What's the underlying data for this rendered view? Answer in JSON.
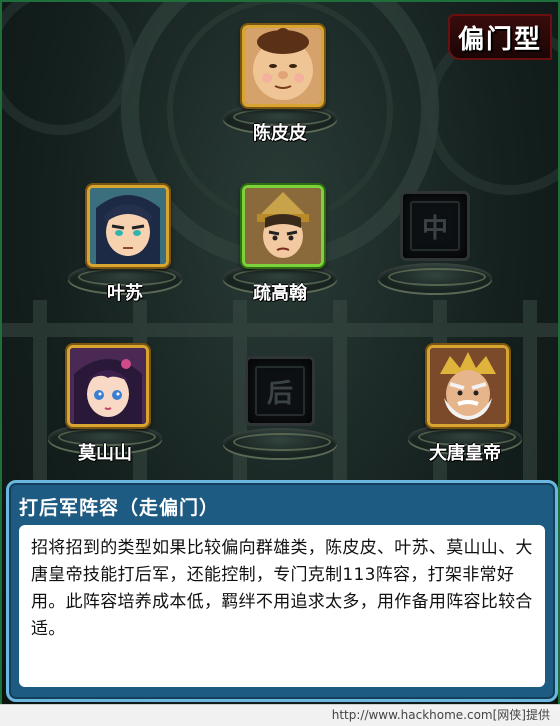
{
  "category_tag": "偏门型",
  "formation": {
    "heroes": [
      {
        "name": "陈皮皮",
        "frame": "gold"
      },
      {
        "name": "叶苏",
        "frame": "gold"
      },
      {
        "name": "疏高翰",
        "frame": "green"
      },
      {
        "name": "莫山山",
        "frame": "gold"
      },
      {
        "name": "大唐皇帝",
        "frame": "gold"
      }
    ],
    "empty_slots": [
      {
        "label": "中"
      },
      {
        "label": "后"
      }
    ]
  },
  "info": {
    "title": "打后军阵容（走偏门）",
    "body": "招将招到的类型如果比较偏向群雄类，陈皮皮、叶苏、莫山山、大唐皇帝技能打后军，还能控制，专门克制113阵容，打架非常好用。此阵容培养成本低，羁绊不用追求太多，用作备用阵容比较合适。"
  },
  "footer": "http://www.hackhome.com[网侠]提供",
  "colors": {
    "gold_frame": "#d9a531",
    "green_frame": "#7bd23a",
    "panel_blue": "#1e5b83",
    "tag_red": "#3a0c0c"
  }
}
